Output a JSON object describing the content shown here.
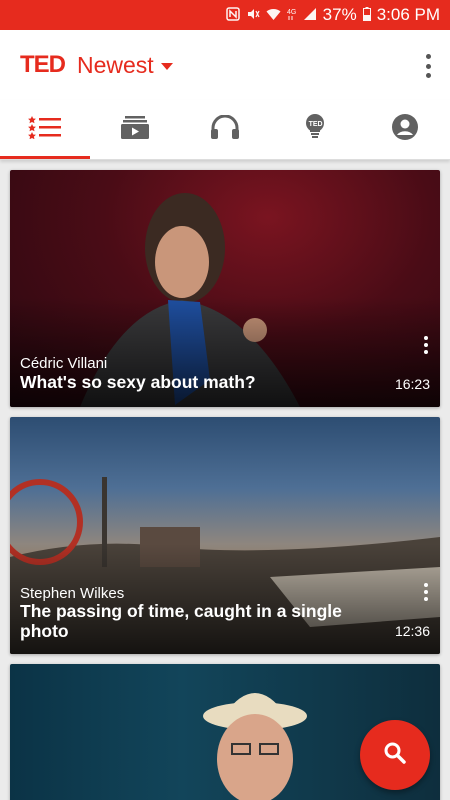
{
  "status_bar": {
    "battery": "37%",
    "time": "3:06 PM",
    "icons": [
      "nfc-icon",
      "mute-icon",
      "wifi-icon",
      "4g-icon",
      "signal-icon",
      "battery-icon"
    ]
  },
  "app_bar": {
    "logo": "TED",
    "section": "Newest"
  },
  "tabs": [
    {
      "name": "list",
      "icon": "list-icon",
      "active": true
    },
    {
      "name": "playlists",
      "icon": "playlist-icon",
      "active": false
    },
    {
      "name": "podcasts",
      "icon": "headphones-icon",
      "active": false
    },
    {
      "name": "ideas",
      "icon": "lightbulb-icon",
      "active": false
    },
    {
      "name": "profile",
      "icon": "account-icon",
      "active": false
    }
  ],
  "talks": [
    {
      "speaker": "Cédric Villani",
      "title": "What's so sexy about math?",
      "duration": "16:23"
    },
    {
      "speaker": "Stephen Wilkes",
      "title": "The passing of time, caught in a single photo",
      "duration": "12:36"
    },
    {
      "speaker": "",
      "title": "",
      "duration": ""
    }
  ],
  "colors": {
    "accent": "#e62b1e",
    "icon_gray": "#616161"
  }
}
